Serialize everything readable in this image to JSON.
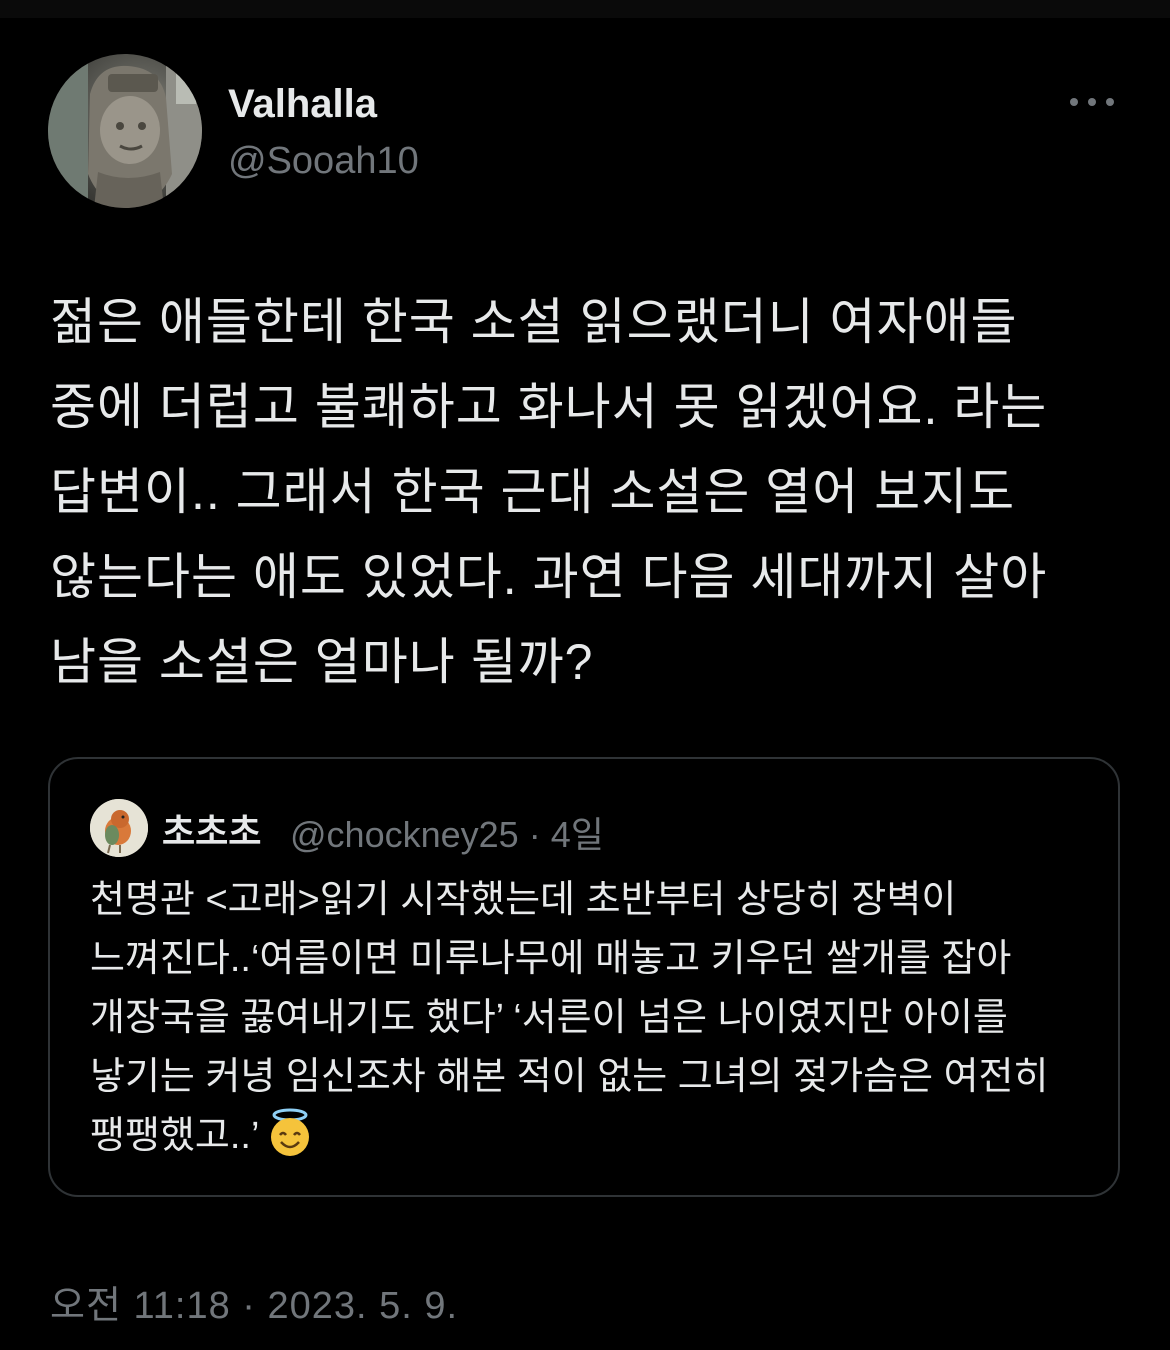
{
  "tweet": {
    "author_name": "Valhalla",
    "author_handle": "@Sooah10",
    "text": "젊은 애들한테 한국 소설 읽으랬더니 여자애들 중에  더럽고 불쾌하고 화나서 못 읽겠어요. 라는 답변이.. 그래서 한국 근대 소설은 열어 보지도 않는다는 애도 있었다.  과연 다음 세대까지 살아 남을 소설은 얼마나 될까?",
    "timestamp": "오전 11:18 · 2023. 5. 9."
  },
  "quote": {
    "author_name": "초초초",
    "author_handle": "@chockney25",
    "separator": "·",
    "age": "4일",
    "text": "천명관 <고래>읽기 시작했는데 초반부터 상당히 장벽이 느껴진다..‘여름이면 미루나무에 매놓고 키우던 쌀개를 잡아 개장국을 끓여내기도 했다’ ‘서른이 넘은 나이였지만 아이를 낳기는 커녕 임신조차 해본 적이 없는 그녀의 젖가슴은 여전히 팽팽했고..’",
    "emoji": "smiling-face-with-halo"
  },
  "icons": {
    "more": "more-horizontal-icon"
  },
  "colors": {
    "background": "#000000",
    "primary_text": "#e7e9ea",
    "secondary_text": "#71767b",
    "border": "#2f3336"
  }
}
